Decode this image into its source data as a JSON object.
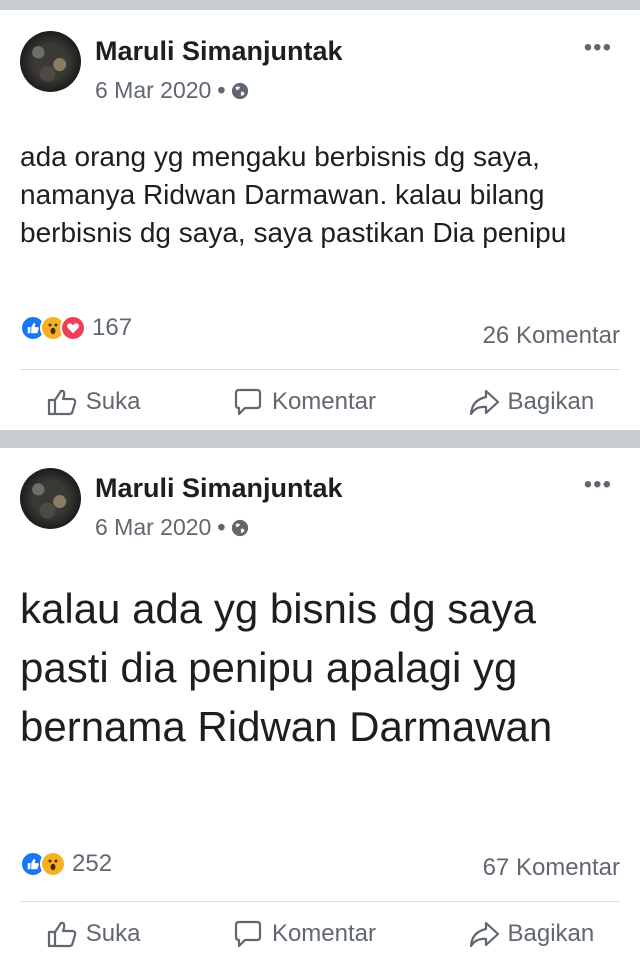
{
  "posts": [
    {
      "author": "Maruli Simanjuntak",
      "date": "6 Mar 2020",
      "dot": "•",
      "more": "•••",
      "text": "ada orang yg mengaku berbisnis dg saya, namanya Ridwan Darmawan. kalau bilang berbisnis dg saya, saya pastikan Dia penipu",
      "reactions": [
        "like-icon",
        "wow-icon",
        "love-icon"
      ],
      "reaction_count": "167",
      "comments": "26 Komentar",
      "actions": {
        "like": "Suka",
        "comment": "Komentar",
        "share": "Bagikan"
      }
    },
    {
      "author": "Maruli Simanjuntak",
      "date": "6 Mar 2020",
      "dot": "•",
      "more": "•••",
      "text": "kalau ada yg bisnis dg saya pasti dia penipu apalagi yg bernama Ridwan Darmawan",
      "reactions": [
        "like-icon",
        "wow-icon"
      ],
      "reaction_count": "252",
      "comments": "67 Komentar",
      "actions": {
        "like": "Suka",
        "comment": "Komentar",
        "share": "Bagikan"
      }
    }
  ],
  "colors": {
    "like": "#1877f2",
    "wow": "#f7b125",
    "love": "#f33e58",
    "separator": "#c9ccd1"
  }
}
